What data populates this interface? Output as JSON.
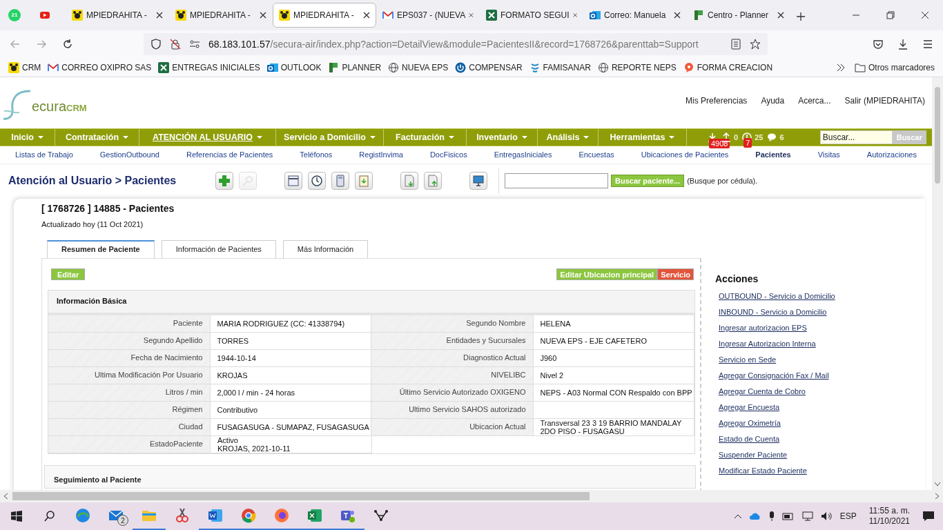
{
  "browser": {
    "pinned": [
      {
        "kind": "whatsapp",
        "badge": "21"
      },
      {
        "kind": "youtube"
      }
    ],
    "tabs": [
      {
        "label": "MPIEDRAHITA -",
        "kind": "crm",
        "selected": false
      },
      {
        "label": "MPIEDRAHITA -",
        "kind": "crm",
        "selected": false
      },
      {
        "label": "MPIEDRAHITA -",
        "kind": "crm",
        "selected": true
      },
      {
        "label": "EPS037 - (NUEVA",
        "kind": "gmail",
        "selected": false
      },
      {
        "label": "FORMATO SEGUI",
        "kind": "excel",
        "selected": false
      },
      {
        "label": "Correo: Manuela",
        "kind": "outlook",
        "selected": false
      },
      {
        "label": "Centro - Planner",
        "kind": "planner",
        "selected": false
      }
    ],
    "url_host": "68.183.101.57",
    "url_path": "/secura-air/index.php?action=DetailView&module=PacientesII&record=1768726&parenttab=Support",
    "bookmarks": [
      {
        "label": "CRM",
        "kind": "crm"
      },
      {
        "label": "CORREO OXIPRO SAS",
        "kind": "gmail"
      },
      {
        "label": "ENTREGAS INICIALES",
        "kind": "excel"
      },
      {
        "label": "OUTLOOK",
        "kind": "outlook"
      },
      {
        "label": "PLANNER",
        "kind": "planner"
      },
      {
        "label": "NUEVA EPS",
        "kind": "globe"
      },
      {
        "label": "COMPENSAR",
        "kind": "power"
      },
      {
        "label": "FAMISANAR",
        "kind": "fami"
      },
      {
        "label": "REPORTE NEPS",
        "kind": "globe"
      },
      {
        "label": "FORMA CREACION",
        "kind": "forma"
      }
    ],
    "other_bookmarks": "Otros marcadores"
  },
  "crm": {
    "logo_main": "ecura",
    "logo_suffix": "CRM",
    "top_links": [
      "Mis Preferencias",
      "Ayuda",
      "Acerca...",
      "Salir (MPIEDRAHITA)"
    ],
    "nav": [
      {
        "label": "Inicio",
        "selected": false
      },
      {
        "label": "Contratación",
        "selected": false
      },
      {
        "label": "ATENCIÓN AL USUARIO",
        "selected": true
      },
      {
        "label": "Servicio a Domicilio",
        "selected": false
      },
      {
        "label": "Facturación",
        "selected": false
      },
      {
        "label": "Inventario",
        "selected": false
      },
      {
        "label": "Análisis",
        "selected": false
      },
      {
        "label": "Herramientas",
        "selected": false
      }
    ],
    "counters": [
      {
        "kind": "download",
        "badge": "4908"
      },
      {
        "kind": "upload",
        "count": "0"
      },
      {
        "kind": "alert",
        "count": "25",
        "badge": "7"
      },
      {
        "kind": "chat",
        "count": "6"
      }
    ],
    "search": {
      "value": "Buscar...",
      "button": "Buscar"
    },
    "subnav": [
      {
        "label": "Listas de Trabajo",
        "selected": false
      },
      {
        "label": "GestionOutbound",
        "selected": false
      },
      {
        "label": "Referencias de Pacientes",
        "selected": false
      },
      {
        "label": "Teléfonos",
        "selected": false
      },
      {
        "label": "RegistInvima",
        "selected": false
      },
      {
        "label": "DocFisicos",
        "selected": false
      },
      {
        "label": "EntregasIniciales",
        "selected": false
      },
      {
        "label": "Encuestas",
        "selected": false
      },
      {
        "label": "Ubicaciones de Pacientes",
        "selected": false
      },
      {
        "label": "Pacientes",
        "selected": true
      },
      {
        "label": "Visitas",
        "selected": false
      },
      {
        "label": "Autorizaciones",
        "selected": false
      }
    ],
    "page_title": "Atención al Usuario > Pacientes",
    "toolbar": [
      {
        "kind": "add",
        "disabled": false
      },
      {
        "kind": "search",
        "disabled": true
      },
      {
        "kind": "calendar",
        "disabled": false
      },
      {
        "kind": "clock",
        "disabled": false
      },
      {
        "kind": "calculator",
        "disabled": false
      },
      {
        "kind": "clipboard",
        "disabled": false
      },
      {
        "kind": "import",
        "disabled": false
      },
      {
        "kind": "export",
        "disabled": false
      },
      {
        "kind": "monitor",
        "disabled": false
      }
    ],
    "patient_search": {
      "button": "Buscar paciente...",
      "hint": "(Busque por cédula)."
    }
  },
  "record": {
    "title": "[ 1768726 ] 14885 - Pacientes",
    "updated": "Actualizado hoy (11 Oct 2021)",
    "tabs": [
      {
        "label": "Resumen de Paciente",
        "selected": true
      },
      {
        "label": "Información de Pacientes",
        "selected": false
      },
      {
        "label": "Más Información",
        "selected": false
      }
    ],
    "edit_button": "Editar",
    "buttons": [
      {
        "label": "Editar Ubicacion principal",
        "kind": "primary"
      },
      {
        "label": "Servicio",
        "kind": "danger"
      }
    ],
    "section": "Información Básica",
    "rows": [
      {
        "left": {
          "label": "Paciente",
          "value": "MARIA RODRIGUEZ (CC: 41338794)"
        },
        "right": {
          "label": "Segundo Nombre",
          "value": "HELENA"
        }
      },
      {
        "left": {
          "label": "Segundo Apellido",
          "value": "TORRES"
        },
        "right": {
          "label": "Entidades y Sucursales",
          "value": "NUEVA EPS - EJE CAFETERO"
        }
      },
      {
        "left": {
          "label": "Fecha de Nacimiento",
          "value": "1944-10-14"
        },
        "right": {
          "label": "Diagnostico Actual",
          "value": "J960"
        }
      },
      {
        "left": {
          "label": "Ultima Modificación Por Usuario",
          "value": "KROJAS"
        },
        "right": {
          "label": "NIVELIBC",
          "value": "Nivel 2"
        }
      },
      {
        "left": {
          "label": "Litros / min",
          "value": "2,000 l / min - 24 horas"
        },
        "right": {
          "label": "Último Servicio Autorizado OXIGENO",
          "value": "NEPS - A03 Normal CON Respaldo con BPP"
        }
      },
      {
        "left": {
          "label": "Régimen",
          "value": "Contributivo"
        },
        "right": {
          "label": "Ultimo Servicio SAHOS autorizado"
        }
      },
      {
        "left": {
          "label": "Ciudad",
          "value": "FUSAGASUGA - SUMAPAZ, FUSAGASUGA"
        },
        "right": {
          "label": "Ubicacion Actual",
          "value": "Transversal 23 3 19 BARRIO MANDALAY 2DO PISO - FUSAGASU"
        }
      },
      {
        "left": {
          "label": "EstadoPaciente",
          "value": "Activo\nKROJAS, 2021-10-11"
        }
      }
    ],
    "section2": "Seguimiento al Paciente",
    "actions_title": "Acciones",
    "actions": [
      "OUTBOUND - Servicio a Domicilio",
      "INBOUND - Servicio a Domicilio",
      "Ingresar autorizacion EPS",
      "Ingresar Autorizacion Interna",
      "Servicio en Sede",
      "Agregar Consignación Fax / Mail",
      "Agregar Cuenta de Cobro",
      "Agregar Encuesta",
      "Agregar Oximetría",
      "Estado de Cuenta",
      "Suspender Paciente",
      "Modificar Estado Paciente"
    ]
  },
  "taskbar": {
    "apps": [
      {
        "kind": "edge",
        "running": false
      },
      {
        "kind": "mail",
        "badge": "2",
        "running": false
      },
      {
        "kind": "folder",
        "running": true
      },
      {
        "kind": "snip",
        "running": false
      },
      {
        "kind": "word",
        "running": true
      },
      {
        "kind": "chrome",
        "running": true
      },
      {
        "kind": "firefox",
        "running": true
      },
      {
        "kind": "excel",
        "running": true
      },
      {
        "kind": "teams",
        "running": true
      },
      {
        "kind": "network",
        "running": false
      }
    ],
    "language": "ESP",
    "time": "11:55 a. m.",
    "date": "11/10/2021"
  }
}
